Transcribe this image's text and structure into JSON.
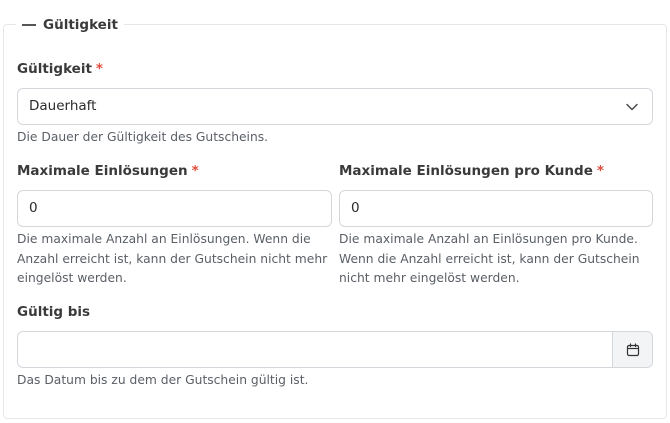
{
  "section": {
    "title": "Gültigkeit"
  },
  "validity": {
    "label": "Gültigkeit",
    "required_mark": "*",
    "value": "Dauerhaft",
    "help": "Die Dauer der Gültigkeit des Gutscheins."
  },
  "max_redemptions": {
    "label": "Maximale Einlösungen",
    "required_mark": "*",
    "value": "0",
    "help": "Die maximale Anzahl an Einlösungen. Wenn die Anzahl erreicht ist, kann der Gutschein nicht mehr eingelöst werden."
  },
  "max_redemptions_per_customer": {
    "label": "Maximale Einlösungen pro Kunde",
    "required_mark": "*",
    "value": "0",
    "help": "Die maximale Anzahl an Einlösungen pro Kunde. Wenn die Anzahl erreicht ist, kann der Gutschein nicht mehr eingelöst werden."
  },
  "valid_until": {
    "label": "Gültig bis",
    "value": "",
    "help": "Das Datum bis zu dem der Gutschein gültig ist."
  },
  "icons": {
    "select": "chevron-down-icon",
    "date": "calendar-icon"
  }
}
